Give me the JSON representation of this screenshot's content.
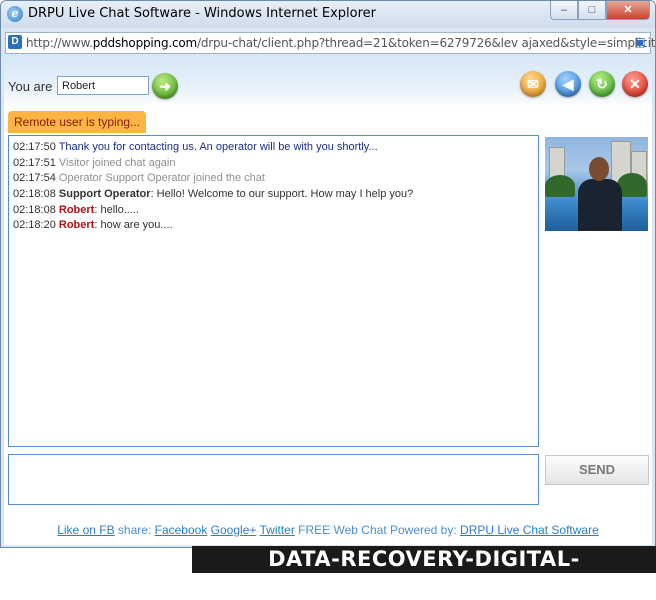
{
  "window": {
    "title": "DRPU Live Chat Software - Windows Internet Explorer",
    "min_glyph": "–",
    "max_glyph": "□",
    "close_glyph": "✕"
  },
  "address_bar": {
    "prefix": "http://www.",
    "host": "pddshopping.com",
    "path": "/drpu-chat/client.php?thread=21&token=6279726&lev ajaxed&style=simplicity"
  },
  "header": {
    "you_are_label": "You are",
    "name_value": "Robert"
  },
  "status": {
    "typing_text": "Remote user is typing..."
  },
  "messages": [
    {
      "time": "02:17:50",
      "sender": "",
      "text": "Thank you for contacting us. An operator will be with you shortly...",
      "style": "blue"
    },
    {
      "time": "02:17:51",
      "sender": "",
      "text": "Visitor joined chat again",
      "style": "grey"
    },
    {
      "time": "02:17:54",
      "sender": "",
      "text": "Operator Support Operator joined the chat",
      "style": "grey"
    },
    {
      "time": "02:18:08",
      "sender": "Support Operator",
      "text": ": Hello! Welcome to our support. How may I help you?",
      "style": "operator"
    },
    {
      "time": "02:18:08",
      "sender": "Robert",
      "text": ": hello.....",
      "style": "user"
    },
    {
      "time": "02:18:20",
      "sender": "Robert",
      "text": ": how are you....",
      "style": "user"
    }
  ],
  "send_button": "SEND",
  "footer": {
    "like": "Like on FB",
    "share": " share: ",
    "facebook": "Facebook",
    "google": "Google+",
    "twitter": "Twitter",
    "powered": " FREE Web Chat Powered by: ",
    "product": "DRPU Live Chat Software"
  },
  "watermark": "DATA-RECOVERY-DIGITAL-CAMERA.COM",
  "colors": {
    "accent_blue": "#4f8fd0",
    "typing_bg": "#fbb545",
    "user_name": "#b0121b",
    "system_blue": "#1a2f8c"
  }
}
